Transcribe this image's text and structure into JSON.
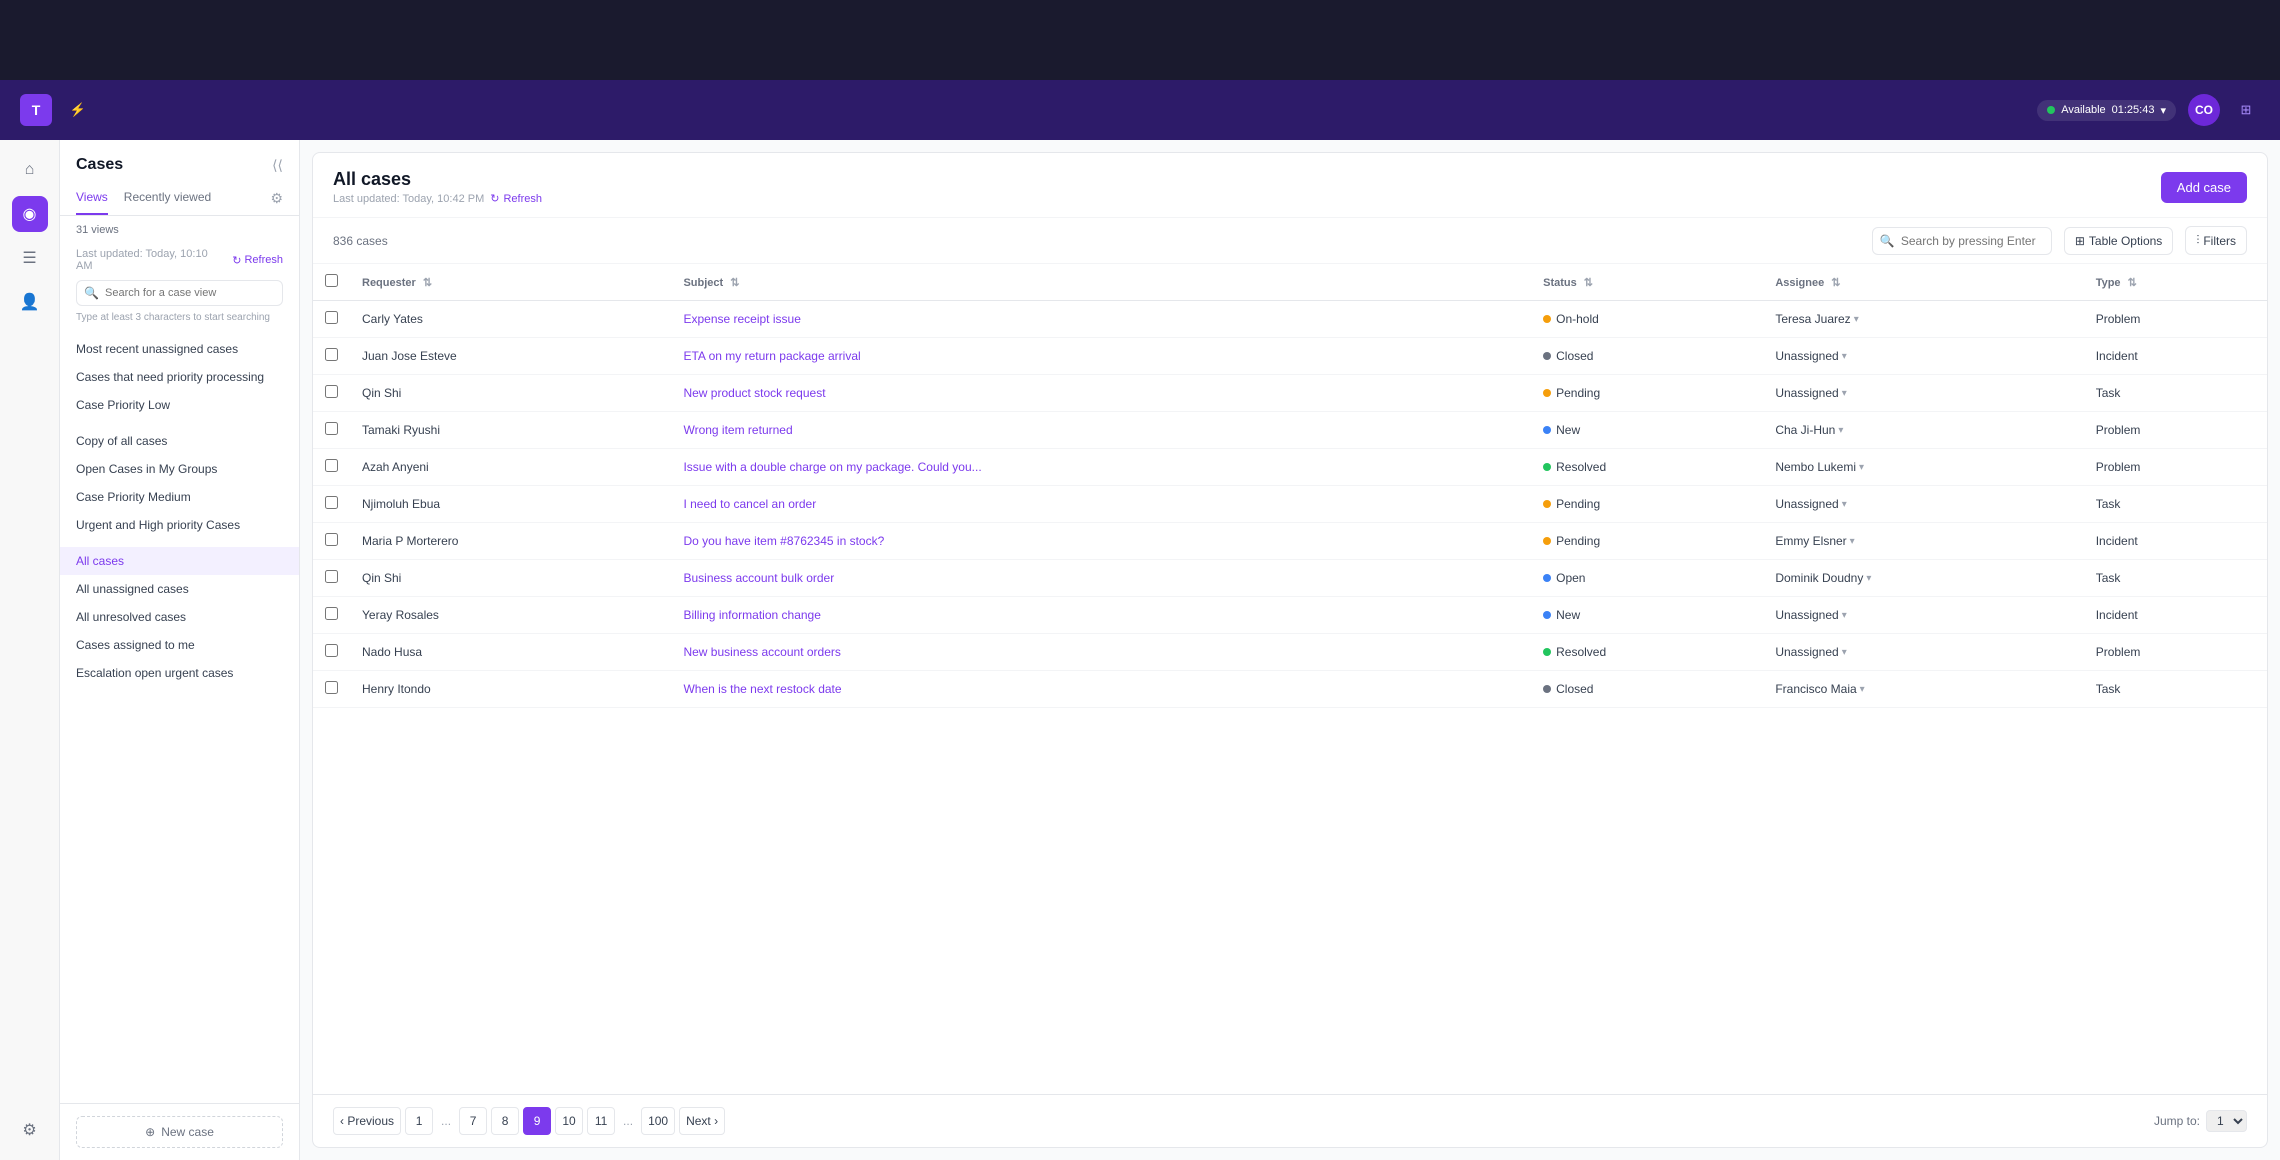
{
  "topbar": {
    "logo_text": "T",
    "status_text": "Available",
    "status_time": "01:25:43",
    "avatar_initials": "CO"
  },
  "sidebar": {
    "icons": [
      {
        "name": "home-icon",
        "symbol": "⌂",
        "active": false
      },
      {
        "name": "cases-icon",
        "symbol": "◉",
        "active": true
      },
      {
        "name": "list-icon",
        "symbol": "☰",
        "active": false
      },
      {
        "name": "person-icon",
        "symbol": "👤",
        "active": false
      },
      {
        "name": "settings-icon",
        "symbol": "⚙",
        "active": false
      }
    ]
  },
  "cases_panel": {
    "title": "Cases",
    "tabs": [
      {
        "label": "Views",
        "active": true
      },
      {
        "label": "Recently viewed",
        "active": false
      }
    ],
    "views_count": "31 views",
    "last_updated": "Last updated: Today, 10:10 AM",
    "refresh_label": "Refresh",
    "search_placeholder": "Search for a case view",
    "search_hint": "Type at least 3 characters to start searching",
    "nav_items_group1": [
      "Most recent unassigned cases",
      "Cases that need priority processing",
      "Case Priority Low"
    ],
    "nav_items_group2": [
      "Copy of all cases",
      "Open Cases in My Groups",
      "Case Priority Medium",
      "Urgent and High priority Cases"
    ],
    "nav_items_group3": [
      "All cases",
      "All unassigned cases",
      "All unresolved cases",
      "Cases assigned to me",
      "Escalation open urgent cases"
    ],
    "new_case_label": "New case"
  },
  "main": {
    "title": "All cases",
    "last_updated": "Last updated: Today, 10:42 PM",
    "refresh_label": "Refresh",
    "add_case_label": "Add case",
    "case_count": "836 cases",
    "search_placeholder": "Search by pressing Enter",
    "table_options_label": "Table Options",
    "filters_label": "Filters",
    "columns": [
      {
        "label": "Requester",
        "sortable": true
      },
      {
        "label": "Subject",
        "sortable": true
      },
      {
        "label": "Status",
        "sortable": true
      },
      {
        "label": "Assignee",
        "sortable": true
      },
      {
        "label": "Type",
        "sortable": true
      }
    ],
    "rows": [
      {
        "requester": "Carly Yates",
        "subject": "Expense receipt issue",
        "status": "On-hold",
        "status_type": "onhold",
        "assignee": "Teresa Juarez",
        "type": "Problem"
      },
      {
        "requester": "Juan Jose Esteve",
        "subject": "ETA on my return package arrival",
        "status": "Closed",
        "status_type": "closed",
        "assignee": "Unassigned",
        "type": "Incident"
      },
      {
        "requester": "Qin Shi",
        "subject": "New product stock request",
        "status": "Pending",
        "status_type": "pending",
        "assignee": "Unassigned",
        "type": "Task"
      },
      {
        "requester": "Tamaki Ryushi",
        "subject": "Wrong item returned",
        "status": "New",
        "status_type": "new",
        "assignee": "Cha Ji-Hun",
        "type": "Problem"
      },
      {
        "requester": "Azah Anyeni",
        "subject": "Issue with a double charge on my package. Could you...",
        "status": "Resolved",
        "status_type": "resolved",
        "assignee": "Nembo Lukemi",
        "type": "Problem"
      },
      {
        "requester": "Njimoluh Ebua",
        "subject": "I need to cancel an order",
        "status": "Pending",
        "status_type": "pending",
        "assignee": "Unassigned",
        "type": "Task"
      },
      {
        "requester": "Maria P Morterero",
        "subject": "Do you have item #8762345 in stock?",
        "status": "Pending",
        "status_type": "pending",
        "assignee": "Emmy Elsner",
        "type": "Incident"
      },
      {
        "requester": "Qin Shi",
        "subject": "Business account bulk order",
        "status": "Open",
        "status_type": "open",
        "assignee": "Dominik Doudny",
        "type": "Task"
      },
      {
        "requester": "Yeray Rosales",
        "subject": "Billing information change",
        "status": "New",
        "status_type": "new",
        "assignee": "Unassigned",
        "type": "Incident"
      },
      {
        "requester": "Nado Husa",
        "subject": "New business account orders",
        "status": "Resolved",
        "status_type": "resolved",
        "assignee": "Unassigned",
        "type": "Problem"
      },
      {
        "requester": "Henry Itondo",
        "subject": "When is the next restock date",
        "status": "Closed",
        "status_type": "closed",
        "assignee": "Francisco Maia",
        "type": "Task"
      }
    ],
    "pagination": {
      "prev_label": "Previous",
      "next_label": "Next",
      "pages": [
        "1",
        "...",
        "7",
        "8",
        "9",
        "10",
        "11",
        "...",
        "100"
      ],
      "current_page": "9",
      "jump_label": "Jump to: 1"
    }
  }
}
